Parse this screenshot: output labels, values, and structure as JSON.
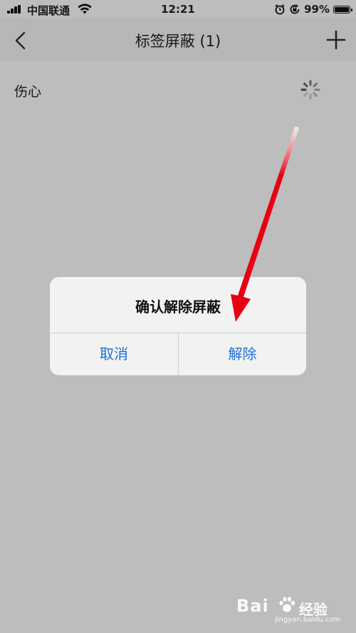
{
  "status_bar": {
    "carrier": "中国联通",
    "time": "12:21",
    "battery_percent": "99%",
    "battery_level": 0.99,
    "icons": [
      "signal-icon",
      "wifi-icon",
      "alarm-icon",
      "orientation-lock-icon",
      "battery-icon"
    ]
  },
  "nav": {
    "title": "标签屏蔽 (1)",
    "back_icon": "chevron-left-icon",
    "add_icon": "plus-icon"
  },
  "list": {
    "items": [
      {
        "label": "伤心",
        "status_icon": "loading-spinner-icon"
      }
    ]
  },
  "alert": {
    "title": "确认解除屏蔽",
    "cancel_label": "取消",
    "confirm_label": "解除"
  },
  "colors": {
    "accent": "#1a6fd6",
    "annotation_arrow": "#e60012",
    "overlay": "rgba(0,0,0,0.26)"
  },
  "watermark": {
    "brand": "Bai",
    "brand_cn": "经验",
    "url": "jingyan.baidu.com"
  }
}
